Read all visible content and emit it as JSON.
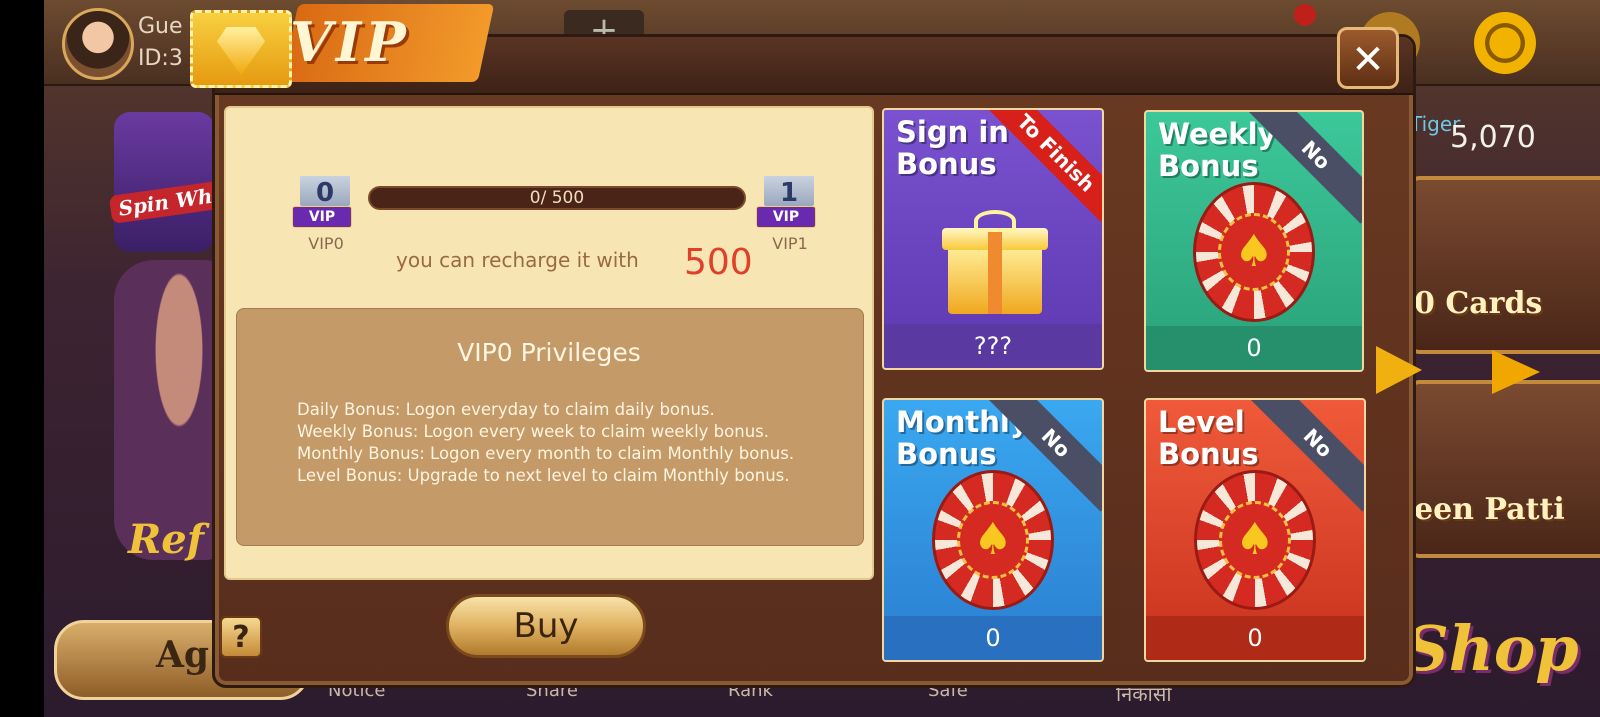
{
  "background": {
    "user": {
      "name": "Gue",
      "id": "ID:3"
    },
    "add_symbol": "+",
    "game_label": "Tiger",
    "coins": "5,070",
    "spin_wheel": "Spin Wheel",
    "refer": "Ref",
    "agent": "Ag",
    "ten_cards": "0 Cards",
    "teen_patti": "een Patti",
    "shop": "Shop",
    "nav": [
      "Notice",
      "Share",
      "Rank",
      "Safe",
      "निकासी"
    ]
  },
  "modal": {
    "title": "VIP",
    "close_label": "✕",
    "progress": {
      "current": 0,
      "target": 500,
      "text": "0/ 500",
      "from_level_num": "0",
      "to_level_num": "1",
      "badge_text": "VIP",
      "from_label": "VIP0",
      "to_label": "VIP1"
    },
    "recharge_text": "you can recharge it with",
    "recharge_amount": "500",
    "privileges": {
      "title": "VIP0 Privileges",
      "lines": [
        "Daily Bonus: Logon everyday to claim daily bonus.",
        "Weekly Bonus: Logon every week to claim weekly bonus.",
        "Monthly Bonus: Logon every month to claim Monthly bonus.",
        "Level Bonus: Upgrade to next level to claim Monthly bonus."
      ]
    },
    "buy_label": "Buy",
    "help_label": "?",
    "cards": {
      "signin": {
        "title": "Sign in\nBonus",
        "ribbon": "To Finish",
        "value": "???",
        "color": "#6a46c0"
      },
      "weekly": {
        "title": "Weekly\nBonus",
        "ribbon": "No",
        "value": "0",
        "color": "#2fb088"
      },
      "monthly": {
        "title": "Monthly\nBonus",
        "ribbon": "No",
        "value": "0",
        "color": "#3290e0"
      },
      "level": {
        "title": "Level\nBonus",
        "ribbon": "No",
        "value": "0",
        "color": "#e0462c"
      }
    }
  }
}
